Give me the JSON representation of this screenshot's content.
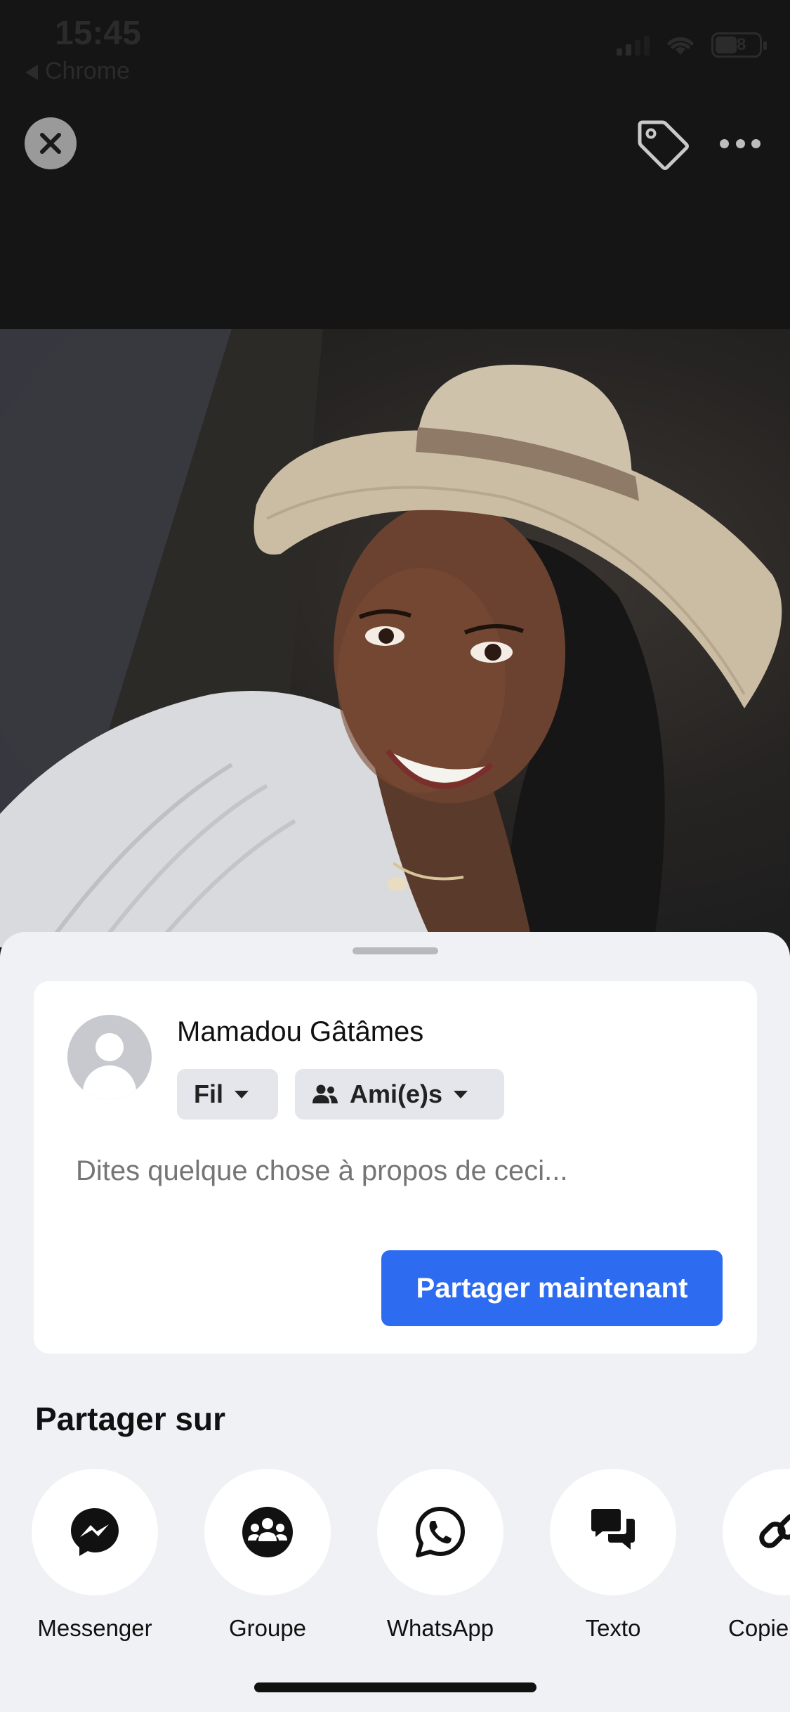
{
  "status_bar": {
    "time": "15:45",
    "back_app": "Chrome",
    "battery": "48"
  },
  "toolbar": {
    "close_icon": "close-icon",
    "tag_icon": "tag-icon",
    "more_icon": "more-icon"
  },
  "composer": {
    "user_name": "Mamadou Gâtâmes",
    "destination": "Fil",
    "audience": "Ami(e)s",
    "placeholder": "Dites quelque chose à propos de ceci...",
    "share_now": "Partager maintenant"
  },
  "share_on": {
    "title": "Partager sur",
    "targets": [
      {
        "label": "Messenger",
        "icon": "messenger-icon"
      },
      {
        "label": "Groupe",
        "icon": "group-icon"
      },
      {
        "label": "WhatsApp",
        "icon": "whatsapp-icon"
      },
      {
        "label": "Texto",
        "icon": "text-message-icon"
      },
      {
        "label": "Copier",
        "icon": "link-icon"
      }
    ]
  },
  "colors": {
    "accent": "#2d6cf0",
    "sheet_bg": "#f0f1f5",
    "top_bg": "#151515"
  }
}
